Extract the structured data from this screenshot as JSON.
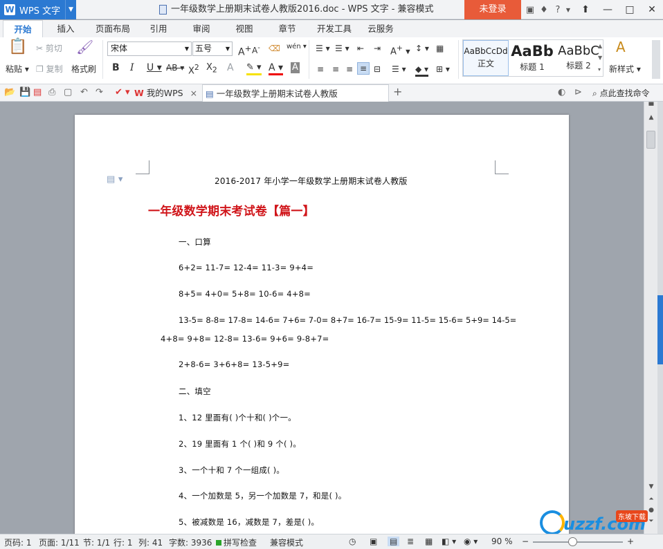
{
  "titlebar": {
    "app_name": "WPS 文字",
    "doc_title": "一年级数学上册期末试卷人教版2016.doc - WPS 文字 - 兼容模式",
    "login_label": "未登录",
    "help_label": "?"
  },
  "menu": {
    "tabs": [
      "开始",
      "插入",
      "页面布局",
      "引用",
      "审阅",
      "视图",
      "章节",
      "开发工具",
      "云服务"
    ]
  },
  "ribbon": {
    "paste": "粘贴",
    "cut": "剪切",
    "copy": "复制",
    "format_painter": "格式刷",
    "font_name": "宋体",
    "font_size": "五号",
    "styles": [
      {
        "sample": "AaBbCcDd",
        "label": "正文"
      },
      {
        "sample": "AaBb",
        "label": "标题 1"
      },
      {
        "sample": "AaBbC",
        "label": "标题 2"
      }
    ],
    "new_style": "新样式"
  },
  "doc_tabs": {
    "my_wps": "我的WPS",
    "active_doc": "一年级数学上册期末试卷人教版2016.doc",
    "search_command": "点此查找命令"
  },
  "document": {
    "subtitle": "2016-2017 年小学一年级数学上册期末试卷人教版",
    "heading": "一年级数学期末考试卷【篇一】",
    "lines": [
      "一、口算",
      "6+2= 11-7= 12-4= 11-3= 9+4=",
      "8+5= 4+0= 5+8= 10-6= 4+8=",
      "13-5= 8-8= 17-8= 14-6= 7+6= 7-0= 8+7= 16-7= 15-9= 11-5= 15-6= 5+9= 14-5=",
      "4+8= 9+8= 12-8= 13-6= 9+6= 9-8+7=",
      "2+8-6= 3+6+8= 13-5+9=",
      "二、填空",
      "1、12 里面有( )个十和( )个一。",
      "2、19 里面有 1 个( )和 9 个( )。",
      "3、一个十和 7 个一组成( )。",
      "4、一个加数是 5，另一个加数是 7，和是( )。",
      "5、被减数是 16，减数是 7，差是( )。"
    ]
  },
  "statusbar": {
    "page_num": "页码: 1",
    "page_of": "页面: 1/11",
    "section": "节: 1/1",
    "row": "行: 1",
    "col": "列: 41",
    "word_count": "字数: 3936",
    "spell_check": "拼写检查",
    "compat_mode": "兼容模式",
    "zoom": "90 %"
  },
  "watermark": {
    "text": "uzzf.com",
    "tag": "东坡下载"
  }
}
